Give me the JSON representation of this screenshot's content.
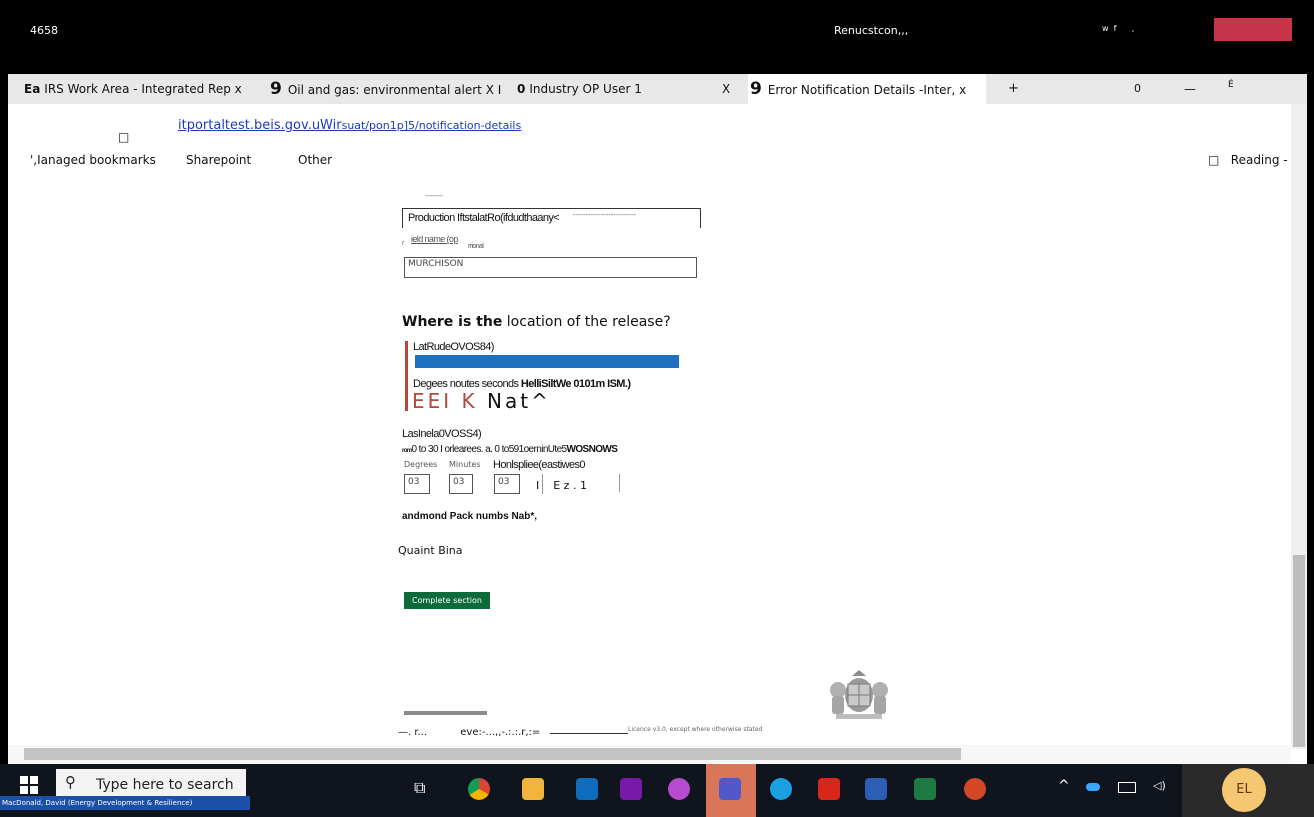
{
  "window": {
    "left_code": "4658",
    "center_title": "Renucstcon,,,",
    "right_glyphs": "w  f      ,",
    "accent_color": "#c8344a"
  },
  "tabs": [
    {
      "icon": "Ea",
      "label": "IRS Work Area - Integrated Rep x"
    },
    {
      "icon": "9",
      "label": "Oil and gas: environmental alert X I"
    },
    {
      "icon": "0",
      "label": "Industry OP User 1"
    },
    {
      "icon": "X",
      "label": ""
    },
    {
      "icon": "9",
      "label": "Error Notification Details -Inter, x"
    }
  ],
  "tab_controls": {
    "new_tab": "+",
    "zero": "0",
    "minimize": "—",
    "restore": "É"
  },
  "address": {
    "checkbox": "□",
    "url_domain": "itportaltest.beis.gov.uWir",
    "url_path": "suat/pon1p]5/notification-details"
  },
  "bookmarks": {
    "items": [
      "',Ianaged bookmarks",
      "Sharepoint",
      "Other"
    ],
    "reading": "□   Reading -"
  },
  "form": {
    "dashes_top": "----------",
    "production_label": "Production IftstalatRo(ifdudthaany<",
    "production_dashes": "-------------------------",
    "field_name_label": "ield name (op",
    "field_name_optional": "rrional",
    "field_name_prefix": "r",
    "field_value": "MURCHISON",
    "question_bold": "Where is the",
    "question_rest": "location of the release?",
    "latitude_label": "LatRudeOVOS84)",
    "latitude_hint_plain": "Degees noutes seconds",
    "latitude_hint_bold": "HelliSiltWe 0101m ISM.)",
    "error_text_red": "EEI K",
    "error_text_black": "Nat^",
    "longitude_label": "LasInela0VOSS4)",
    "longitude_hint_bold1": "rom",
    "longitude_hint_plain": "0 to 30 I orlearees. a. 0 to591oerninUte5",
    "longitude_hint_bold2": "WOSNOWS",
    "col_degrees": "Degrees",
    "col_minutes": "Minutes",
    "col_hemisphere": "Honlspliee(eastiwes0",
    "deg_value": "03",
    "min_value": "03",
    "sec_value": "03",
    "hemisphere_value": "I    E z . 1",
    "block_label": "andmond Pack numbs Nab*,",
    "quadrant_label": "Quaint Bina",
    "complete_button": "Complete section",
    "footer_left": "—. r...",
    "footer_mid": "eve:-...,,-.:.:.r,:=",
    "footer_licence": "Licence v3.0, except where otherwise stated"
  },
  "taskbar": {
    "search_placeholder": "Type here to search",
    "user_strip": "MacDonald, David (Energy Development & Resilience)",
    "avatar_initials": "EL",
    "icons": [
      "task-view-icon",
      "chrome-icon",
      "file-explorer-icon",
      "outlook-icon",
      "onenote-icon",
      "snip-icon",
      "teams-icon",
      "edge-icon",
      "acrobat-icon",
      "word-icon",
      "excel-icon",
      "powerpoint-icon"
    ],
    "tray": [
      "chevron-up-icon",
      "onedrive-icon",
      "battery-icon",
      "volume-icon"
    ]
  }
}
